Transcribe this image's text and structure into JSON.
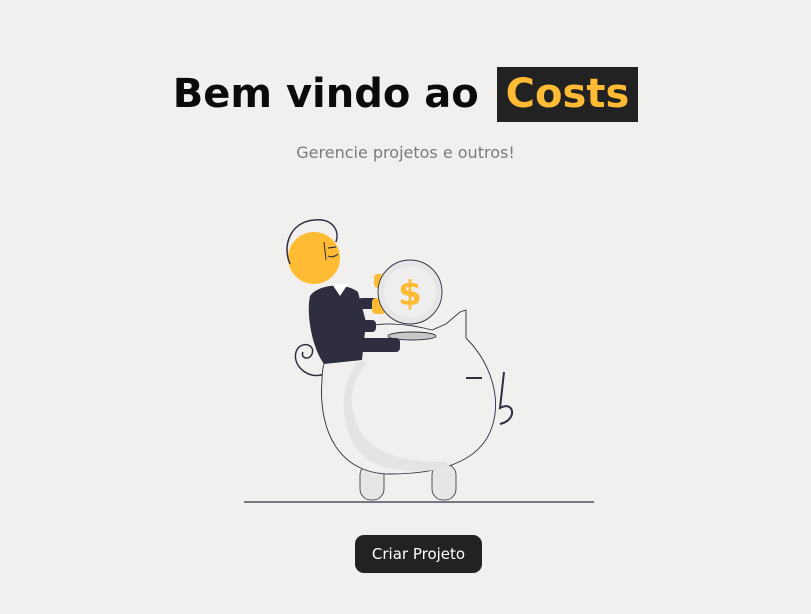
{
  "hero": {
    "title_prefix": "Bem vindo ao",
    "brand_name": "Costs",
    "subtitle": "Gerencie projetos e outros!"
  },
  "illustration": {
    "coin_symbol": "$"
  },
  "cta": {
    "label": "Criar Projeto"
  },
  "colors": {
    "background": "#f1f0ee",
    "brand_highlight_bg": "#222222",
    "brand_text": "#ffbb33",
    "button_bg": "#222222",
    "button_text": "#ffffff",
    "subtitle_text": "#7b7b7b",
    "accent_yellow": "#ffbb33",
    "dark_navy": "#2f2e41"
  },
  "icons": {
    "hero_image": "piggy-bank-illustration"
  }
}
